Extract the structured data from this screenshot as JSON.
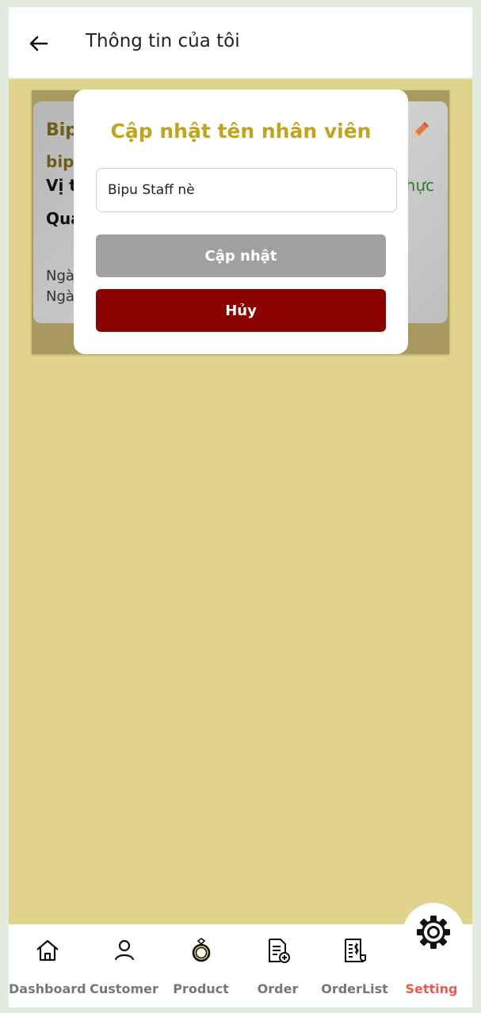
{
  "header": {
    "title": "Thông tin của tôi",
    "back_icon": "arrow-left-icon"
  },
  "profile_card": {
    "name_partial": "Bip",
    "username_partial": "bip",
    "role_partial": "Vị t",
    "status_partial": "hực",
    "section_partial": "Quả",
    "date1_partial": "Ngà",
    "date2_partial": "Ngà",
    "edit_icon": "pencil-icon"
  },
  "modal": {
    "title": "Cập nhật tên nhân viên",
    "input_value": "Bipu Staff nè",
    "update_label": "Cập nhật",
    "cancel_label": "Hủy"
  },
  "nav": {
    "items": [
      {
        "label": "Dashboard",
        "icon": "home-icon"
      },
      {
        "label": "Customer",
        "icon": "user-icon"
      },
      {
        "label": "Product",
        "icon": "ring-icon"
      },
      {
        "label": "Order",
        "icon": "order-add-icon"
      },
      {
        "label": "OrderList",
        "icon": "receipt-icon"
      },
      {
        "label": "Setting",
        "icon": "gear-icon"
      }
    ],
    "active": "Setting"
  },
  "colors": {
    "background": "#e0d38b",
    "modal_title": "#bfa41c",
    "update_button": "#a0a0a0",
    "cancel_button": "#8b0000",
    "active_nav": "#ee5b4d"
  }
}
